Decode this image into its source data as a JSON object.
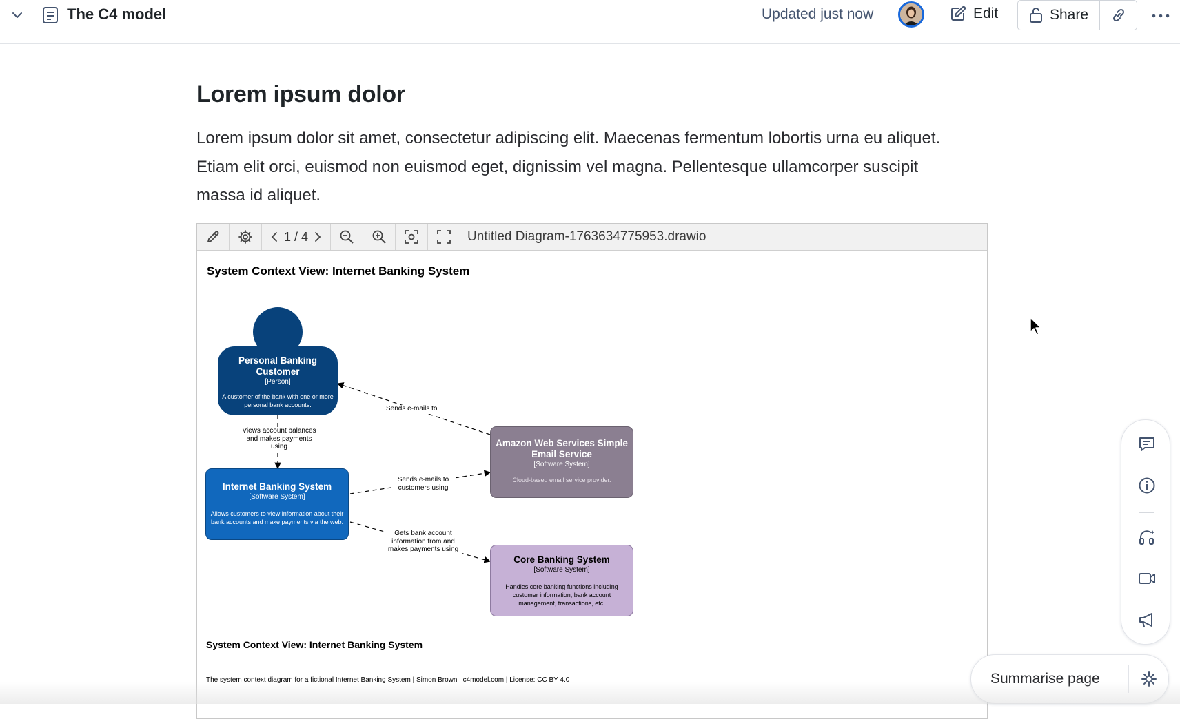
{
  "header": {
    "page_title": "The C4 model",
    "updated_text": "Updated just now",
    "edit_label": "Edit",
    "share_label": "Share",
    "icons": [
      "chevron-down-icon",
      "page-icon",
      "avatar",
      "edit-icon",
      "lock-icon",
      "link-icon",
      "more-icon"
    ]
  },
  "content": {
    "heading": "Lorem ipsum dolor",
    "paragraph": "Lorem ipsum dolor sit amet, consectetur adipiscing elit. Maecenas fermentum lobortis urna eu aliquet. Etiam elit orci, euismod non euismod eget, dignissim vel magna. Pellentesque ullamcorper suscipit massa id aliquet."
  },
  "viewer": {
    "page_indicator": "1 / 4",
    "filename": "Untitled Diagram-1763634775953.drawio",
    "toolbar_icons": [
      "pencil-icon",
      "gear-icon",
      "chevron-left-icon",
      "chevron-right-icon",
      "zoom-out-icon",
      "zoom-in-icon",
      "fit-icon",
      "fullscreen-icon"
    ]
  },
  "diagram": {
    "title": "System Context View: Internet Banking System",
    "person": {
      "name_line1": "Personal Banking",
      "name_line2": "Customer",
      "type": "[Person]",
      "desc_line1": "A customer of the bank with one or more",
      "desc_line2": "personal bank accounts.",
      "color": "#08427b"
    },
    "internet_banking": {
      "name": "Internet Banking System",
      "type": "[Software System]",
      "desc_line1": "Allows customers to view information about their",
      "desc_line2": "bank accounts and make payments via the web.",
      "color": "#1168bd"
    },
    "aws_ses": {
      "name_line1": "Amazon Web Services Simple",
      "name_line2": "Email Service",
      "type": "[Software System]",
      "desc": "Cloud-based email service provider.",
      "color": "#8b7f91"
    },
    "core_banking": {
      "name": "Core Banking System",
      "type": "[Software System]",
      "desc_line1": "Handles core banking functions including",
      "desc_line2": "customer information, bank account",
      "desc_line3": "management, transactions, etc.",
      "color": "#c6b1d6"
    },
    "relations": {
      "sends_emails_to": "Sends e-mails to",
      "views_line1": "Views account balances",
      "views_line2": "and makes payments",
      "views_line3": "using",
      "sends_customers_line1": "Sends e-mails to",
      "sends_customers_line2": "customers using",
      "gets_line1": "Gets bank account",
      "gets_line2": "information from and",
      "gets_line3": "makes payments using"
    },
    "footer_title": "System Context View: Internet Banking System",
    "footer_subtitle": "The system context diagram for a fictional Internet Banking System | Simon Brown | c4model.com | License: CC BY 4.0"
  },
  "rail": {
    "icons": [
      "comment-icon",
      "info-icon",
      "headphones-icon",
      "video-icon",
      "megaphone-icon"
    ]
  },
  "summarise": {
    "label": "Summarise page",
    "icon": "sparkle-icon"
  }
}
